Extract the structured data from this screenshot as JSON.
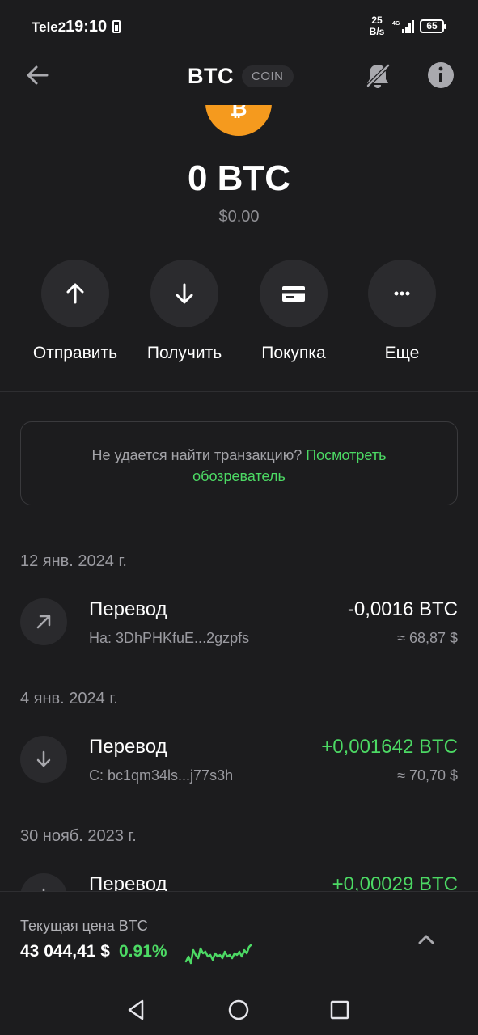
{
  "status_bar": {
    "carrier": "Tele2",
    "time": "19:10",
    "speed_value": "25",
    "speed_unit": "B/s",
    "network": "4G",
    "battery": "65"
  },
  "header": {
    "title": "BTC",
    "badge": "COIN"
  },
  "balance": {
    "amount": "0 BTC",
    "fiat": "$0.00"
  },
  "actions": [
    {
      "label": "Отправить",
      "icon": "arrow-up-icon"
    },
    {
      "label": "Получить",
      "icon": "arrow-down-icon"
    },
    {
      "label": "Покупка",
      "icon": "card-icon"
    },
    {
      "label": "Еще",
      "icon": "more-icon"
    }
  ],
  "notice": {
    "text": "Не удается найти транзакцию?",
    "link": "Посмотреть обозреватель"
  },
  "transactions": [
    {
      "date": "12 янв. 2024 г.",
      "title": "Перевод",
      "address": "На: 3DhPHKfuE...2gzpfs",
      "amount": "-0,0016 BTC",
      "fiat": "≈ 68,87 $",
      "direction": "out"
    },
    {
      "date": "4 янв. 2024 г.",
      "title": "Перевод",
      "address": "С: bc1qm34ls...j77s3h",
      "amount": "+0,001642 BTC",
      "fiat": "≈ 70,70 $",
      "direction": "in"
    },
    {
      "date": "30 нояб. 2023 г.",
      "title": "Перевод",
      "address": "",
      "amount": "+0,00029 BTC",
      "fiat": "",
      "direction": "in"
    }
  ],
  "price_bar": {
    "label": "Текущая цена BTC",
    "price": "43 044,41 $",
    "change": "0.91%"
  },
  "colors": {
    "background": "#1c1c1e",
    "accent_green": "#4cd964",
    "btc_orange": "#f59a1e"
  }
}
